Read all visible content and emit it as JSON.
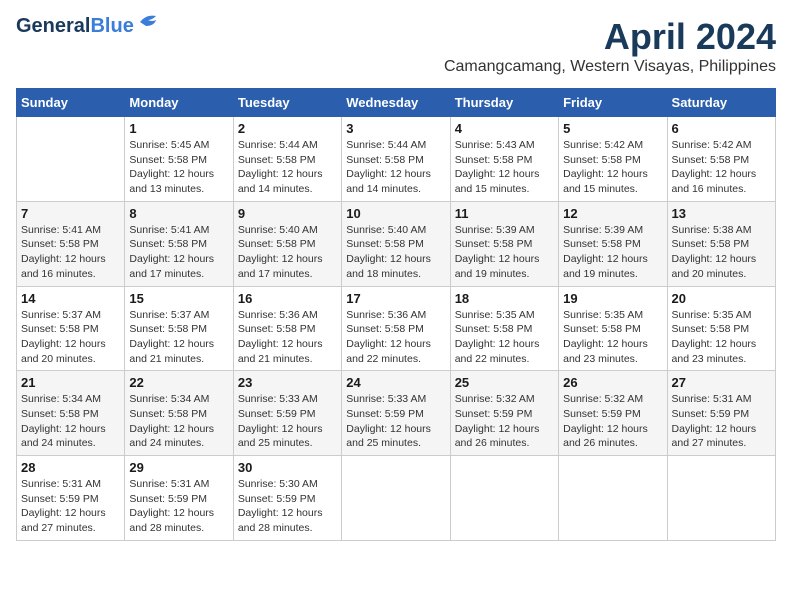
{
  "header": {
    "logo_general": "General",
    "logo_blue": "Blue",
    "month_year": "April 2024",
    "location": "Camangcamang, Western Visayas, Philippines"
  },
  "weekdays": [
    "Sunday",
    "Monday",
    "Tuesday",
    "Wednesday",
    "Thursday",
    "Friday",
    "Saturday"
  ],
  "weeks": [
    [
      {
        "day": "",
        "info": ""
      },
      {
        "day": "1",
        "info": "Sunrise: 5:45 AM\nSunset: 5:58 PM\nDaylight: 12 hours\nand 13 minutes."
      },
      {
        "day": "2",
        "info": "Sunrise: 5:44 AM\nSunset: 5:58 PM\nDaylight: 12 hours\nand 14 minutes."
      },
      {
        "day": "3",
        "info": "Sunrise: 5:44 AM\nSunset: 5:58 PM\nDaylight: 12 hours\nand 14 minutes."
      },
      {
        "day": "4",
        "info": "Sunrise: 5:43 AM\nSunset: 5:58 PM\nDaylight: 12 hours\nand 15 minutes."
      },
      {
        "day": "5",
        "info": "Sunrise: 5:42 AM\nSunset: 5:58 PM\nDaylight: 12 hours\nand 15 minutes."
      },
      {
        "day": "6",
        "info": "Sunrise: 5:42 AM\nSunset: 5:58 PM\nDaylight: 12 hours\nand 16 minutes."
      }
    ],
    [
      {
        "day": "7",
        "info": "Sunrise: 5:41 AM\nSunset: 5:58 PM\nDaylight: 12 hours\nand 16 minutes."
      },
      {
        "day": "8",
        "info": "Sunrise: 5:41 AM\nSunset: 5:58 PM\nDaylight: 12 hours\nand 17 minutes."
      },
      {
        "day": "9",
        "info": "Sunrise: 5:40 AM\nSunset: 5:58 PM\nDaylight: 12 hours\nand 17 minutes."
      },
      {
        "day": "10",
        "info": "Sunrise: 5:40 AM\nSunset: 5:58 PM\nDaylight: 12 hours\nand 18 minutes."
      },
      {
        "day": "11",
        "info": "Sunrise: 5:39 AM\nSunset: 5:58 PM\nDaylight: 12 hours\nand 19 minutes."
      },
      {
        "day": "12",
        "info": "Sunrise: 5:39 AM\nSunset: 5:58 PM\nDaylight: 12 hours\nand 19 minutes."
      },
      {
        "day": "13",
        "info": "Sunrise: 5:38 AM\nSunset: 5:58 PM\nDaylight: 12 hours\nand 20 minutes."
      }
    ],
    [
      {
        "day": "14",
        "info": "Sunrise: 5:37 AM\nSunset: 5:58 PM\nDaylight: 12 hours\nand 20 minutes."
      },
      {
        "day": "15",
        "info": "Sunrise: 5:37 AM\nSunset: 5:58 PM\nDaylight: 12 hours\nand 21 minutes."
      },
      {
        "day": "16",
        "info": "Sunrise: 5:36 AM\nSunset: 5:58 PM\nDaylight: 12 hours\nand 21 minutes."
      },
      {
        "day": "17",
        "info": "Sunrise: 5:36 AM\nSunset: 5:58 PM\nDaylight: 12 hours\nand 22 minutes."
      },
      {
        "day": "18",
        "info": "Sunrise: 5:35 AM\nSunset: 5:58 PM\nDaylight: 12 hours\nand 22 minutes."
      },
      {
        "day": "19",
        "info": "Sunrise: 5:35 AM\nSunset: 5:58 PM\nDaylight: 12 hours\nand 23 minutes."
      },
      {
        "day": "20",
        "info": "Sunrise: 5:35 AM\nSunset: 5:58 PM\nDaylight: 12 hours\nand 23 minutes."
      }
    ],
    [
      {
        "day": "21",
        "info": "Sunrise: 5:34 AM\nSunset: 5:58 PM\nDaylight: 12 hours\nand 24 minutes."
      },
      {
        "day": "22",
        "info": "Sunrise: 5:34 AM\nSunset: 5:58 PM\nDaylight: 12 hours\nand 24 minutes."
      },
      {
        "day": "23",
        "info": "Sunrise: 5:33 AM\nSunset: 5:59 PM\nDaylight: 12 hours\nand 25 minutes."
      },
      {
        "day": "24",
        "info": "Sunrise: 5:33 AM\nSunset: 5:59 PM\nDaylight: 12 hours\nand 25 minutes."
      },
      {
        "day": "25",
        "info": "Sunrise: 5:32 AM\nSunset: 5:59 PM\nDaylight: 12 hours\nand 26 minutes."
      },
      {
        "day": "26",
        "info": "Sunrise: 5:32 AM\nSunset: 5:59 PM\nDaylight: 12 hours\nand 26 minutes."
      },
      {
        "day": "27",
        "info": "Sunrise: 5:31 AM\nSunset: 5:59 PM\nDaylight: 12 hours\nand 27 minutes."
      }
    ],
    [
      {
        "day": "28",
        "info": "Sunrise: 5:31 AM\nSunset: 5:59 PM\nDaylight: 12 hours\nand 27 minutes."
      },
      {
        "day": "29",
        "info": "Sunrise: 5:31 AM\nSunset: 5:59 PM\nDaylight: 12 hours\nand 28 minutes."
      },
      {
        "day": "30",
        "info": "Sunrise: 5:30 AM\nSunset: 5:59 PM\nDaylight: 12 hours\nand 28 minutes."
      },
      {
        "day": "",
        "info": ""
      },
      {
        "day": "",
        "info": ""
      },
      {
        "day": "",
        "info": ""
      },
      {
        "day": "",
        "info": ""
      }
    ]
  ]
}
